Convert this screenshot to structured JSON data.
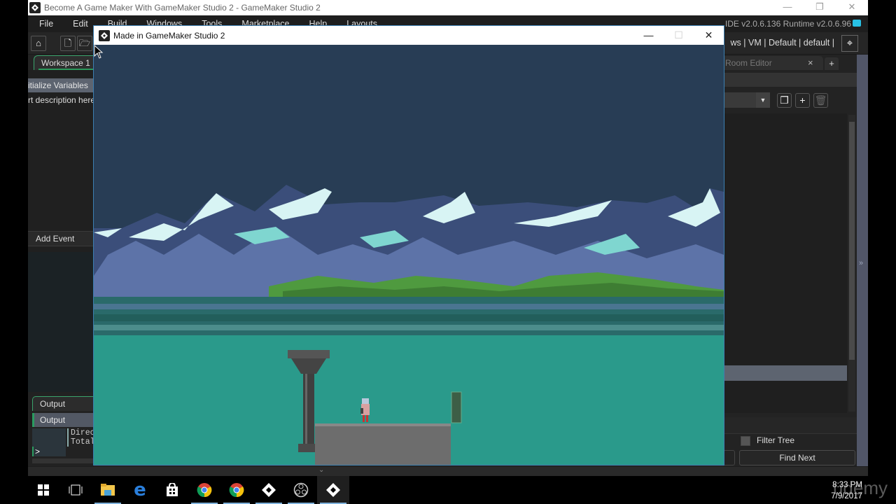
{
  "ide": {
    "title": "Become A Game Maker With GameMaker Studio 2 - GameMaker Studio 2",
    "window_controls": {
      "minimize": "—",
      "restore": "❐",
      "close": "✕"
    },
    "menu": [
      "File",
      "Edit",
      "Build",
      "Windows",
      "Tools",
      "Marketplace",
      "Help",
      "Layouts"
    ],
    "version": "IDE v2.0.6.136 Runtime v2.0.6.96",
    "toolbar": {
      "targets": "ws | VM | Default | default |",
      "target_icon": "target-crosshair-icon"
    },
    "workspace_tab": "Workspace 1",
    "left_panel": {
      "selected_event": "itialize Variables",
      "description": "rt description here",
      "add_event": "Add Event"
    },
    "output": {
      "tab": "Output",
      "header": "Output",
      "lines": [
        "Direc",
        "Total"
      ],
      "prompt": ">"
    },
    "right_panel": {
      "tab": "Room Editor",
      "tab_close": "×",
      "add_tab": "+",
      "filter_tree_label": "Filter Tree",
      "filter_tree_checked": false,
      "find_next": "Find Next",
      "collapse": "»"
    },
    "bottom_toggle": "⌄"
  },
  "game_window": {
    "title": "Made in GameMaker Studio 2",
    "window_controls": {
      "minimize": "—",
      "maximize": "☐",
      "close": "✕"
    },
    "colors": {
      "sky": "#283d55",
      "water": "#2a9a8b",
      "mountain_dark": "#3b4e7a",
      "mountain_mid": "#6a80b8",
      "snow": "#d8f4f4",
      "snow_teal": "#7fd6d0",
      "grass": "#4f9a3f",
      "stone": "#6d6d6d"
    }
  },
  "taskbar": {
    "icons": [
      {
        "name": "start",
        "glyph": "⊞"
      },
      {
        "name": "task-view",
        "glyph": "▭"
      },
      {
        "name": "file-explorer",
        "glyph": "📁"
      },
      {
        "name": "edge",
        "glyph": "e"
      },
      {
        "name": "store",
        "glyph": "🛍"
      },
      {
        "name": "chrome-1",
        "glyph": "◉"
      },
      {
        "name": "chrome-2",
        "glyph": "◉"
      },
      {
        "name": "gamemaker-1",
        "glyph": "◆"
      },
      {
        "name": "obs",
        "glyph": "◎"
      },
      {
        "name": "gamemaker-2",
        "glyph": "◆"
      }
    ],
    "time": "8:33 PM",
    "date": "7/9/2017",
    "watermark": "udemy"
  }
}
